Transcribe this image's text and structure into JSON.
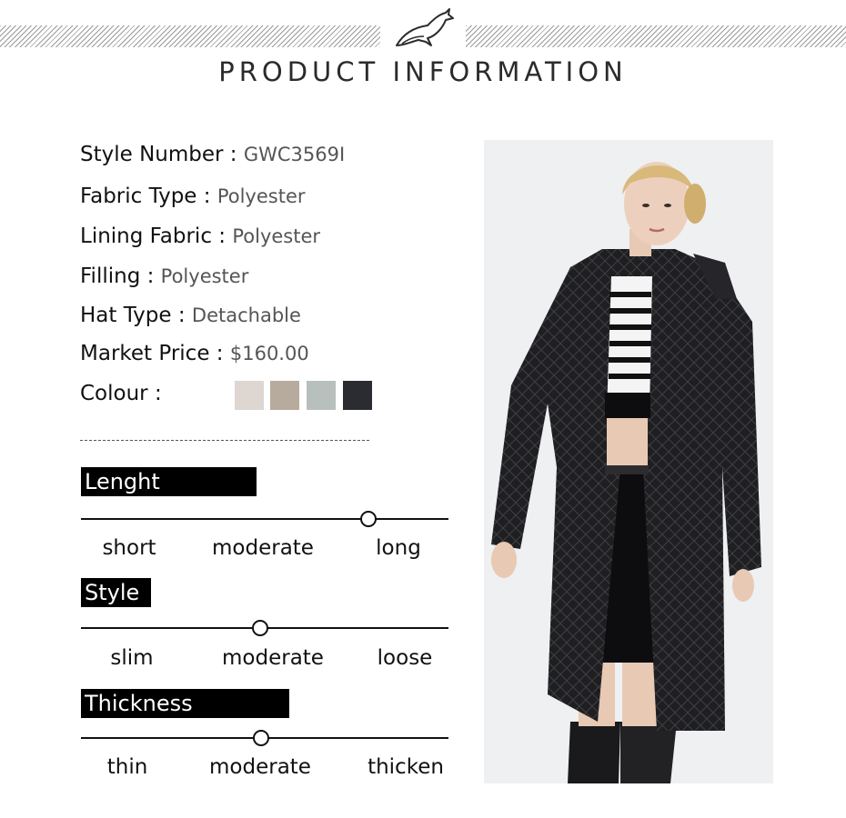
{
  "header": {
    "title": "PRODUCT INFORMATION",
    "logo_icon": "leaping-fox-logo"
  },
  "specs": [
    {
      "label": "Style Number :",
      "value": "GWC3569I"
    },
    {
      "label": "Fabric Type :",
      "value": "Polyester"
    },
    {
      "label": "Lining Fabric :",
      "value": "Polyester"
    },
    {
      "label": "Filling :",
      "value": "Polyester"
    },
    {
      "label": "Hat Type :",
      "value": "Detachable"
    },
    {
      "label": "Market Price :",
      "value": "$160.00"
    }
  ],
  "colour": {
    "label": "Colour :",
    "swatches": [
      "#ddd6d1",
      "#b7ab9d",
      "#b8c0be",
      "#2a2c31"
    ]
  },
  "scales": [
    {
      "title": "Lenght",
      "options": [
        "short",
        "moderate",
        "long"
      ],
      "selected": 2
    },
    {
      "title": "Style",
      "options": [
        "slim",
        "moderate",
        "loose"
      ],
      "selected": 1
    },
    {
      "title": "Thickness",
      "options": [
        "thin",
        "moderate",
        "thicken"
      ],
      "selected": 1
    }
  ]
}
